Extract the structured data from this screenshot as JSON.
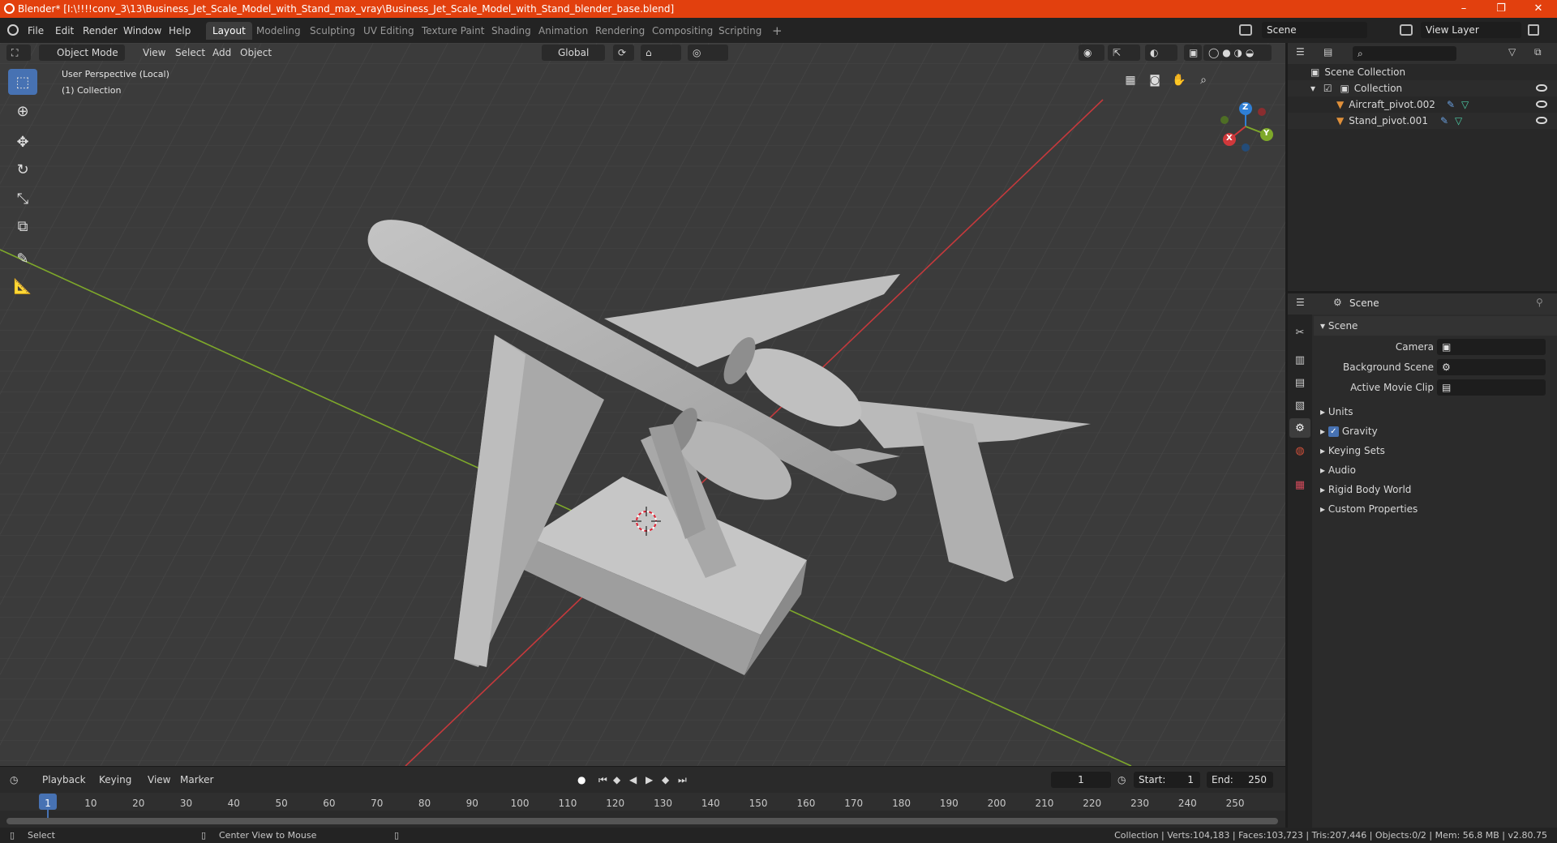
{
  "window": {
    "title": "Blender* [I:\\!!!!conv_3\\13\\Business_Jet_Scale_Model_with_Stand_max_vray\\Business_Jet_Scale_Model_with_Stand_blender_base.blend]",
    "minimize": "–",
    "maximize": "❐",
    "close": "✕"
  },
  "menu": {
    "items": [
      "File",
      "Edit",
      "Render",
      "Window",
      "Help"
    ],
    "workspaces": [
      "Layout",
      "Modeling",
      "Sculpting",
      "UV Editing",
      "Texture Paint",
      "Shading",
      "Animation",
      "Rendering",
      "Compositing",
      "Scripting"
    ],
    "add_workspace": "+",
    "scene": "Scene",
    "view_layer": "View Layer"
  },
  "viewport": {
    "mode": "Object Mode",
    "menus": [
      "View",
      "Select",
      "Add",
      "Object"
    ],
    "transform_orientation": "Global",
    "perspective_label": "User Perspective (Local)",
    "collection_label": "(1) Collection",
    "gizmo": {
      "x": "X",
      "y": "Y",
      "z": "Z"
    }
  },
  "timeline": {
    "menus": [
      "Playback",
      "Keying",
      "View",
      "Marker"
    ],
    "current_frame": "1",
    "start_label": "Start:",
    "start": "1",
    "end_label": "End:",
    "end": "250",
    "ticks": [
      "1",
      "10",
      "20",
      "30",
      "40",
      "50",
      "60",
      "70",
      "80",
      "90",
      "100",
      "110",
      "120",
      "130",
      "140",
      "150",
      "160",
      "170",
      "180",
      "190",
      "200",
      "210",
      "220",
      "230",
      "240",
      "250"
    ]
  },
  "status": {
    "select": "Select",
    "center_view": "Center View to Mouse",
    "stats": "Collection | Verts:104,183 | Faces:103,723 | Tris:207,446 | Objects:0/2 | Mem: 56.8 MB | v2.80.75"
  },
  "outliner": {
    "root": "Scene Collection",
    "collection": "Collection",
    "objects": [
      "Aircraft_pivot.002",
      "Stand_pivot.001"
    ]
  },
  "properties": {
    "context": "Scene",
    "panel_title": "Scene",
    "camera_label": "Camera",
    "background_scene_label": "Background Scene",
    "active_clip_label": "Active Movie Clip",
    "sections": [
      "Units",
      "Gravity",
      "Keying Sets",
      "Audio",
      "Rigid Body World",
      "Custom Properties"
    ]
  },
  "colors": {
    "titlebar": "#e2400e",
    "accent": "#4772b3",
    "axis_x": "#d0383b",
    "axis_y": "#7ea82a",
    "axis_z": "#2f7fd5",
    "model": "#b2b2b2"
  }
}
